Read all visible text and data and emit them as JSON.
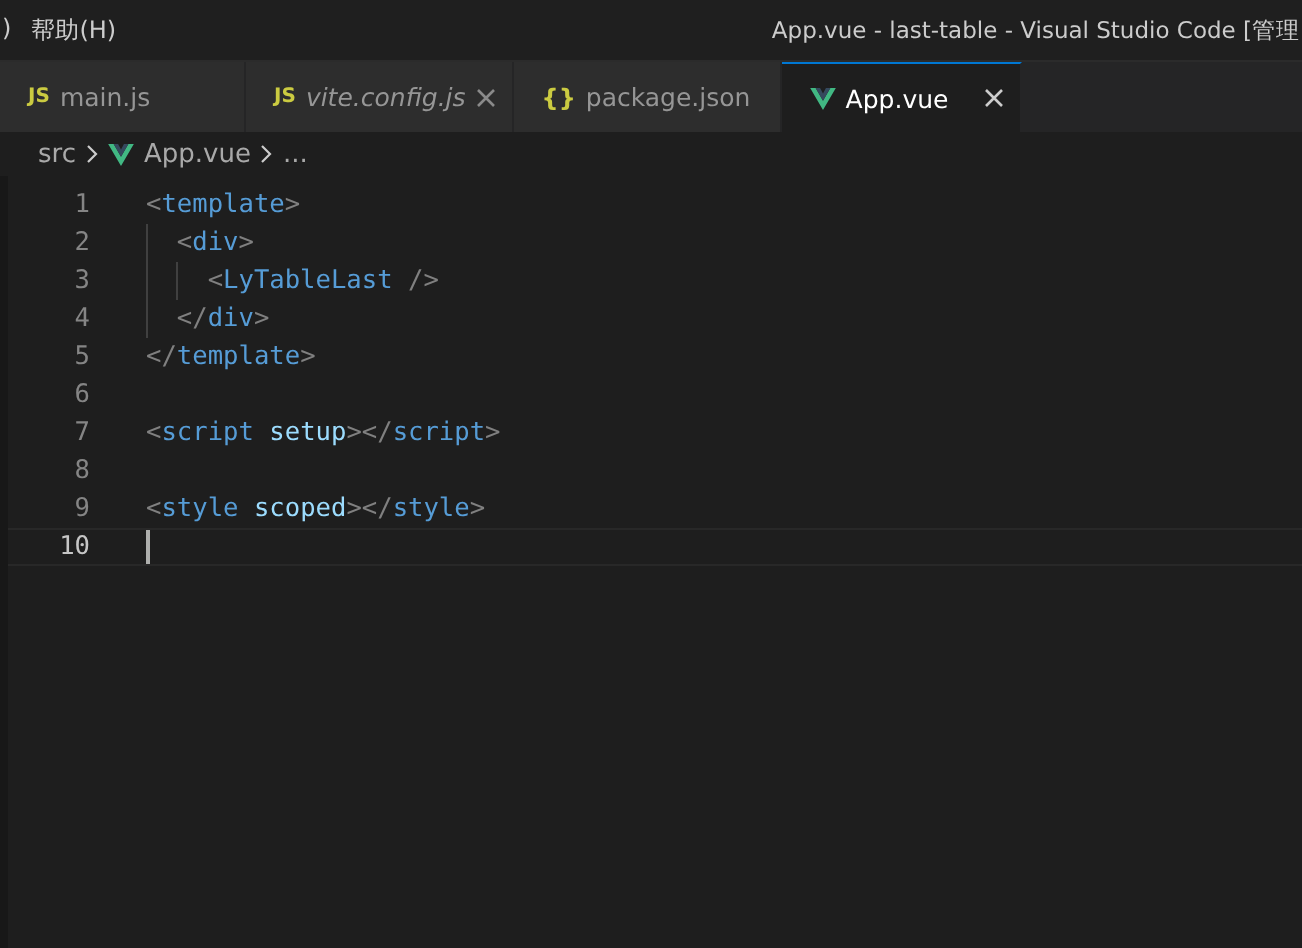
{
  "menu": [
    ")",
    "帮助(H)"
  ],
  "window": {
    "title": "App.vue - last-table - Visual Studio Code [管理"
  },
  "tabs": [
    {
      "label": "main.js",
      "kind": "js",
      "icon_text": "JS",
      "selected": false,
      "preview": false,
      "close": false
    },
    {
      "label": "vite.config.js",
      "kind": "js",
      "icon_text": "JS",
      "selected": false,
      "preview": true,
      "close": true
    },
    {
      "label": "package.json",
      "kind": "json",
      "icon_text": "{}",
      "selected": false,
      "preview": false,
      "close": false
    },
    {
      "label": "App.vue",
      "kind": "vue",
      "selected": true,
      "preview": false,
      "close": true
    }
  ],
  "breadcrumb": [
    {
      "label": "src",
      "kind": "folder"
    },
    {
      "label": "App.vue",
      "kind": "vue"
    },
    {
      "label": "...",
      "kind": "symbol"
    }
  ],
  "lines": [
    {
      "number": "1",
      "current": false,
      "tokens": [
        {
          "text": "<",
          "kind": "punct"
        },
        {
          "text": "template",
          "kind": "tag"
        },
        {
          "text": ">",
          "kind": "punct"
        }
      ]
    },
    {
      "number": "2",
      "current": false,
      "tokens": [
        {
          "text": "  <",
          "kind": "punct"
        },
        {
          "text": "div",
          "kind": "tag"
        },
        {
          "text": ">",
          "kind": "punct"
        }
      ]
    },
    {
      "number": "3",
      "current": false,
      "tokens": [
        {
          "text": "    <",
          "kind": "punct"
        },
        {
          "text": "LyTableLast",
          "kind": "tag"
        },
        {
          "text": " />",
          "kind": "punct"
        }
      ]
    },
    {
      "number": "4",
      "current": false,
      "tokens": [
        {
          "text": "  </",
          "kind": "punct"
        },
        {
          "text": "div",
          "kind": "tag"
        },
        {
          "text": ">",
          "kind": "punct"
        }
      ]
    },
    {
      "number": "5",
      "current": false,
      "tokens": [
        {
          "text": "</",
          "kind": "punct"
        },
        {
          "text": "template",
          "kind": "tag"
        },
        {
          "text": ">",
          "kind": "punct"
        }
      ]
    },
    {
      "number": "6",
      "current": false
    },
    {
      "number": "7",
      "current": false,
      "tokens": [
        {
          "text": "<",
          "kind": "punct"
        },
        {
          "text": "script",
          "kind": "tag"
        },
        {
          "text": " setup",
          "kind": "attr"
        },
        {
          "text": "></",
          "kind": "punct"
        },
        {
          "text": "script",
          "kind": "tag"
        },
        {
          "text": ">",
          "kind": "punct"
        }
      ]
    },
    {
      "number": "8",
      "current": false
    },
    {
      "number": "9",
      "current": false,
      "tokens": [
        {
          "text": "<",
          "kind": "punct"
        },
        {
          "text": "style",
          "kind": "tag"
        },
        {
          "text": " scoped",
          "kind": "attr"
        },
        {
          "text": "></",
          "kind": "punct"
        },
        {
          "text": "style",
          "kind": "tag"
        },
        {
          "text": ">",
          "kind": "punct"
        }
      ]
    },
    {
      "number": "10",
      "current": true
    }
  ]
}
